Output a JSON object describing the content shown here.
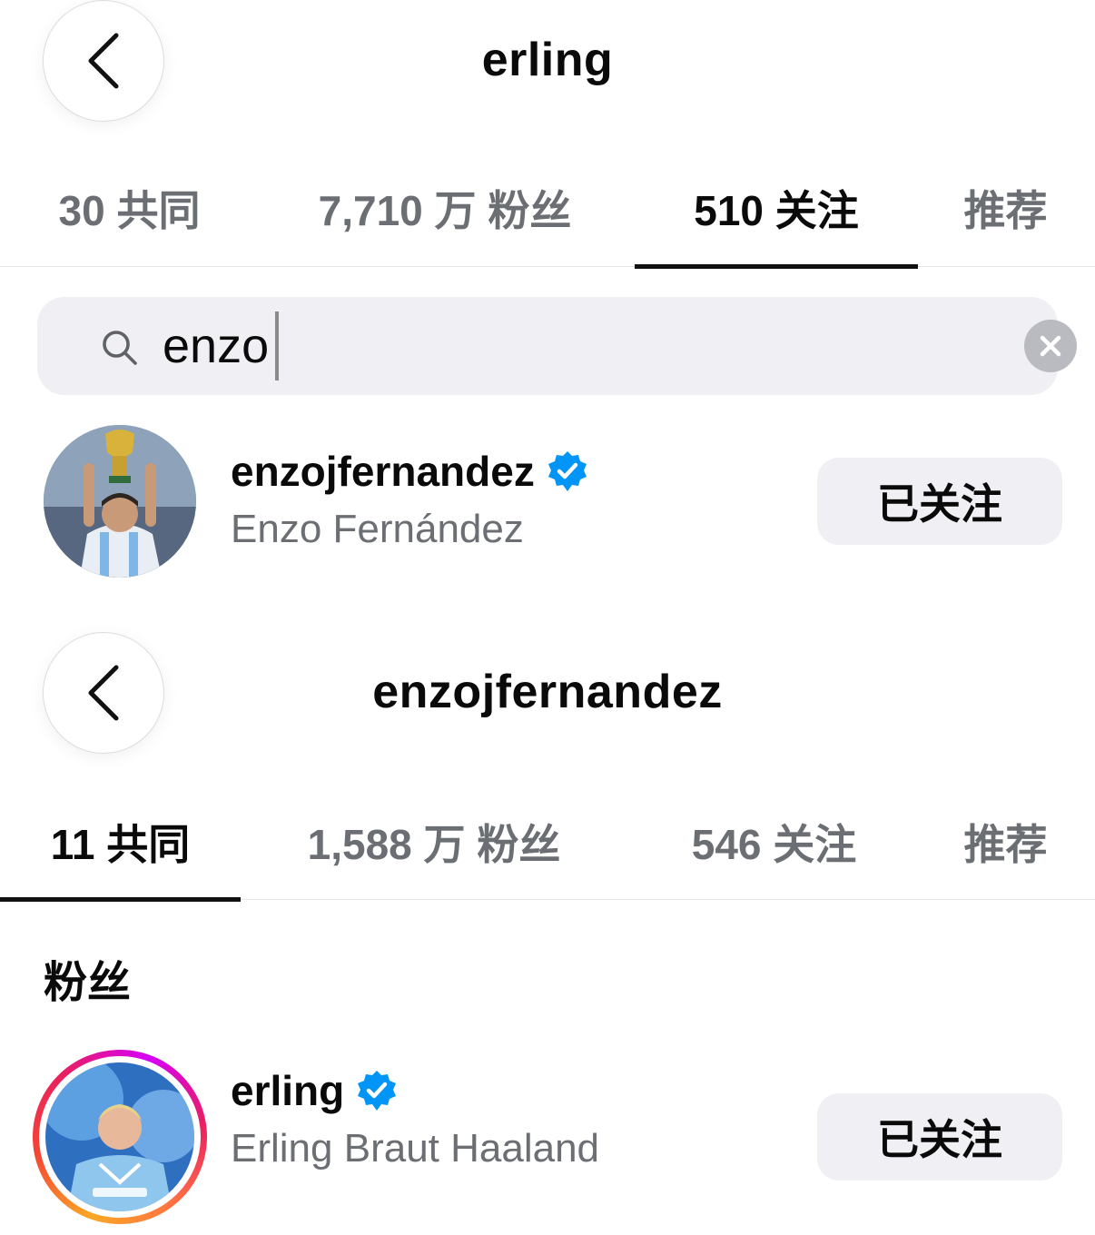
{
  "top": {
    "header": {
      "title": "erling"
    },
    "tabs": [
      {
        "label": "30 共同",
        "active": false
      },
      {
        "label": "7,710 万 粉丝",
        "active": false
      },
      {
        "label": "510 关注",
        "active": true
      },
      {
        "label": "推荐",
        "active": false
      }
    ],
    "search": {
      "query": "enzo"
    },
    "result": {
      "username": "enzojfernandez",
      "full_name": "Enzo Fernández",
      "verified": true,
      "button_label": "已关注"
    }
  },
  "bottom": {
    "header": {
      "title": "enzojfernandez"
    },
    "tabs": [
      {
        "label": "11 共同",
        "active": true
      },
      {
        "label": "1,588 万 粉丝",
        "active": false
      },
      {
        "label": "546 关注",
        "active": false
      },
      {
        "label": "推荐",
        "active": false
      }
    ],
    "section_label": "粉丝",
    "result": {
      "username": "erling",
      "full_name": "Erling Braut Haaland",
      "verified": true,
      "has_story_ring": true,
      "button_label": "已关注"
    }
  },
  "colors": {
    "verified_blue": "#0095f6",
    "secondary_text": "#6b6f74",
    "chip_bg": "#efeff4"
  },
  "icons": [
    "chevron-left-icon",
    "search-icon",
    "clear-icon",
    "verified-badge-icon"
  ]
}
